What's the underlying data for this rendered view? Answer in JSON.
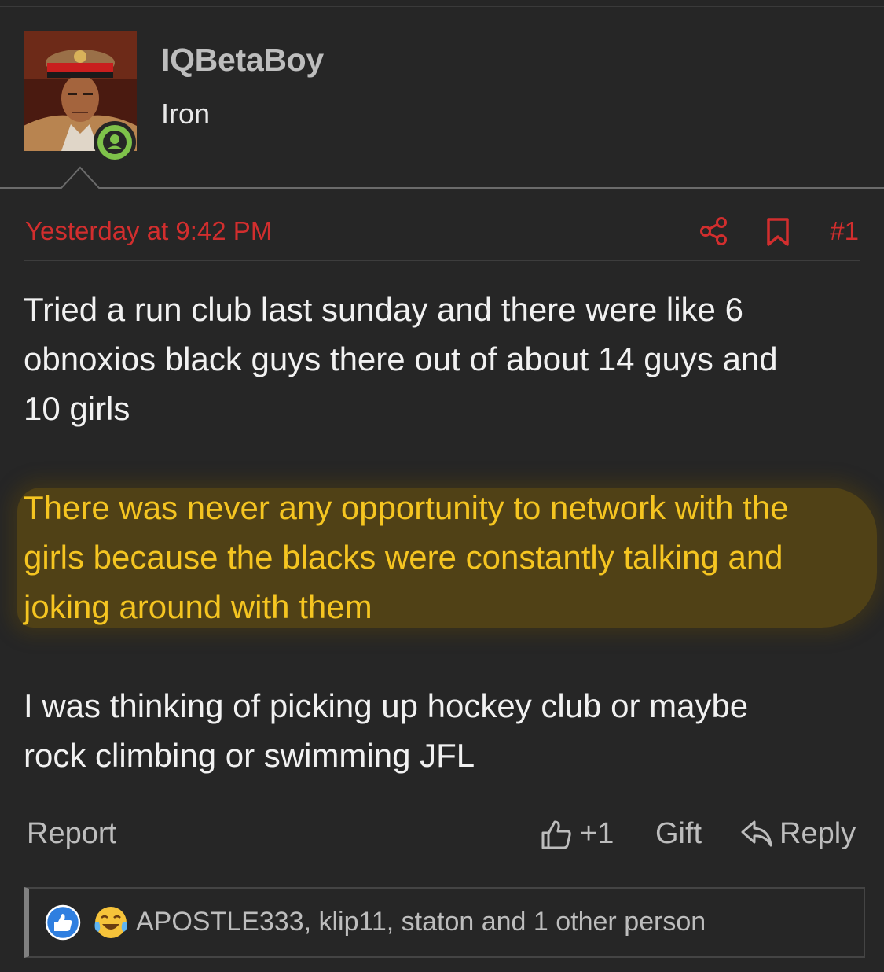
{
  "post": {
    "author": {
      "username": "IQBetaBoy",
      "title": "Iron",
      "avatar_icon": "avatar-photo",
      "status_icon": "online-user-icon"
    },
    "meta": {
      "timestamp": "Yesterday at 9:42 PM",
      "post_number": "#1",
      "share_icon": "share-icon",
      "bookmark_icon": "bookmark-icon"
    },
    "body": {
      "paragraph_1": [
        "Tried a run club last sunday and there were like 6",
        "obnoxios black guys there out of about 14 guys and",
        "10 girls"
      ],
      "paragraph_2": [
        "There was never any opportunity to network with the",
        "girls because the blacks were constantly talking and",
        "joking around with them"
      ],
      "paragraph_3": [
        "I was thinking of picking up hockey club or maybe",
        "rock climbing or swimming JFL"
      ]
    },
    "actions": {
      "report_label": "Report",
      "like_count": "+1",
      "gift_label": "Gift",
      "reply_label": "Reply"
    },
    "reactions": {
      "users_text": "APOSTLE333, klip11, staton and 1 other person",
      "icons": [
        "like-reaction-icon",
        "laughing-crying-reaction-icon"
      ]
    }
  },
  "colors": {
    "background": "#262626",
    "accent_red": "#d22e2e",
    "highlight_text": "#f5c521",
    "muted_text": "#bdbdbd",
    "online_green": "#7ec24a",
    "like_blue": "#2f7fe0"
  }
}
